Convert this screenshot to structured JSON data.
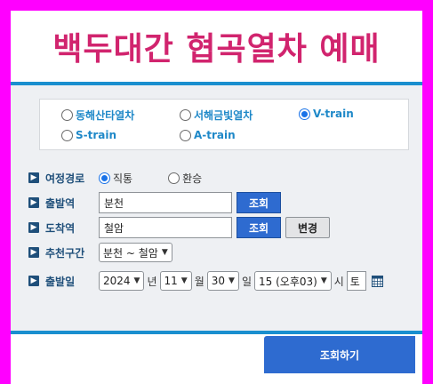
{
  "banner": {
    "title": "백두대간 협곡열차 예매"
  },
  "train_options": [
    {
      "label": "동해산타열차",
      "selected": false
    },
    {
      "label": "서해금빛열차",
      "selected": false
    },
    {
      "label": "V-train",
      "selected": true
    },
    {
      "label": "S-train",
      "selected": false
    },
    {
      "label": "A-train",
      "selected": false
    }
  ],
  "form": {
    "route_type": {
      "label": "여정경로",
      "options": [
        {
          "label": "직통",
          "selected": true
        },
        {
          "label": "환승",
          "selected": false
        }
      ]
    },
    "departure": {
      "label": "출발역",
      "value": "분천",
      "button": "조회"
    },
    "arrival": {
      "label": "도착역",
      "value": "철암",
      "button": "조회",
      "change_button": "변경"
    },
    "recommended": {
      "label": "추천구간",
      "value": "분천 ~ 철암"
    },
    "date": {
      "label": "출발일",
      "year": "2024",
      "year_unit": "년",
      "month": "11",
      "month_unit": "월",
      "day": "30",
      "day_unit": "일",
      "hour": "15 (오후03)",
      "hour_unit": "시",
      "weekday": "토"
    }
  },
  "search_button": "조회하기",
  "colors": {
    "accent": "#1a8fcf",
    "title": "#d1246e",
    "button": "#2e6bd0",
    "border": "#ff00ff"
  }
}
